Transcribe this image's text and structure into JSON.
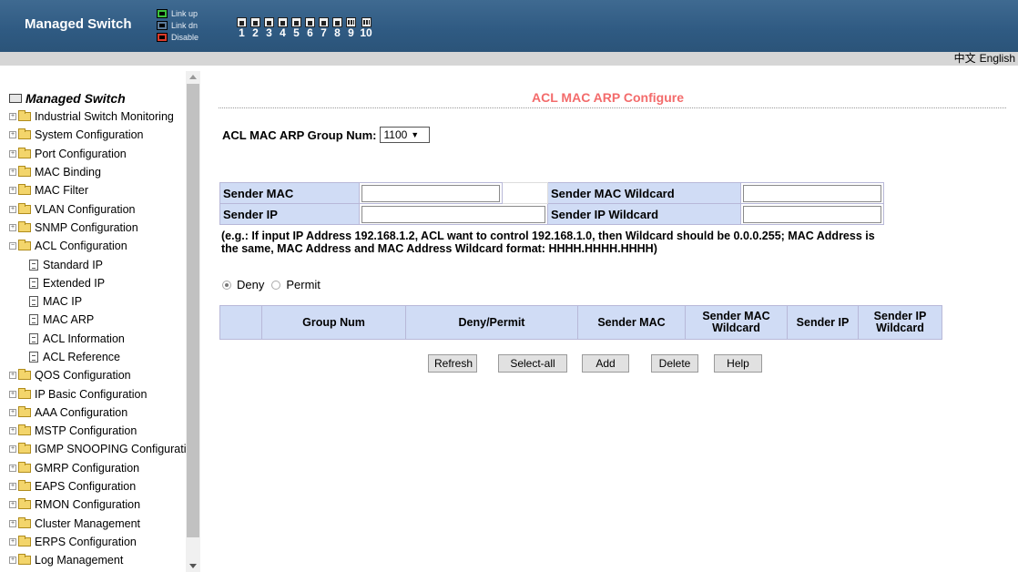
{
  "header": {
    "brand": "Managed Switch",
    "legend": [
      {
        "label": "Link up",
        "color": "#3cc23c"
      },
      {
        "label": "Link dn",
        "color": "#2d4f70"
      },
      {
        "label": "Disable",
        "color": "#d93b2b"
      }
    ],
    "ports": [
      {
        "num": "1",
        "type": "copper"
      },
      {
        "num": "2",
        "type": "copper"
      },
      {
        "num": "3",
        "type": "copper"
      },
      {
        "num": "4",
        "type": "copper"
      },
      {
        "num": "5",
        "type": "copper"
      },
      {
        "num": "6",
        "type": "copper"
      },
      {
        "num": "7",
        "type": "copper"
      },
      {
        "num": "8",
        "type": "copper"
      },
      {
        "num": "9",
        "type": "fiber"
      },
      {
        "num": "10",
        "type": "fiber"
      }
    ]
  },
  "language": {
    "chinese": "中文",
    "english": "English"
  },
  "sidebar": {
    "root": "Managed Switch",
    "items": [
      {
        "label": "Industrial Switch Monitoring",
        "expanded": false
      },
      {
        "label": "System Configuration",
        "expanded": false
      },
      {
        "label": "Port Configuration",
        "expanded": false
      },
      {
        "label": "MAC Binding",
        "expanded": false
      },
      {
        "label": "MAC Filter",
        "expanded": false
      },
      {
        "label": "VLAN Configuration",
        "expanded": false
      },
      {
        "label": "SNMP Configuration",
        "expanded": false
      },
      {
        "label": "ACL Configuration",
        "expanded": true
      },
      {
        "label": "QOS Configuration",
        "expanded": false
      },
      {
        "label": "IP Basic Configuration",
        "expanded": false
      },
      {
        "label": "AAA Configuration",
        "expanded": false
      },
      {
        "label": "MSTP Configuration",
        "expanded": false
      },
      {
        "label": "IGMP SNOOPING Configuration",
        "expanded": false
      },
      {
        "label": "GMRP Configuration",
        "expanded": false
      },
      {
        "label": "EAPS Configuration",
        "expanded": false
      },
      {
        "label": "RMON Configuration",
        "expanded": false
      },
      {
        "label": "Cluster Management",
        "expanded": false
      },
      {
        "label": "ERPS Configuration",
        "expanded": false
      },
      {
        "label": "Log Management",
        "expanded": false
      }
    ],
    "acl_children": [
      "Standard IP",
      "Extended IP",
      "MAC IP",
      "MAC ARP",
      "ACL Information",
      "ACL Reference"
    ]
  },
  "main": {
    "title": "ACL MAC ARP Configure",
    "group_label": "ACL MAC ARP Group Num:",
    "group_value": "1100",
    "form": {
      "sender_mac": "Sender MAC",
      "sender_mac_wildcard": "Sender MAC Wildcard",
      "sender_ip": "Sender IP",
      "sender_ip_wildcard": "Sender IP Wildcard",
      "values": {
        "sender_mac": "",
        "sender_mac_wildcard": "",
        "sender_ip": "",
        "sender_ip_wildcard": ""
      }
    },
    "hint": "(e.g.: If input IP Address 192.168.1.2, ACL want to control 192.168.1.0, then Wildcard should be 0.0.0.255; MAC Address is the same, MAC Address and MAC Address Wildcard format: HHHH.HHHH.HHHH)",
    "radio": {
      "deny": "Deny",
      "permit": "Permit",
      "selected": "Deny"
    },
    "table": {
      "columns": [
        "",
        "Group Num",
        "Deny/Permit",
        "Sender MAC",
        "Sender MAC Wildcard",
        "Sender IP",
        "Sender IP Wildcard"
      ]
    },
    "buttons": {
      "refresh": "Refresh",
      "select_all": "Select-all",
      "add": "Add",
      "delete": "Delete",
      "help": "Help"
    }
  }
}
